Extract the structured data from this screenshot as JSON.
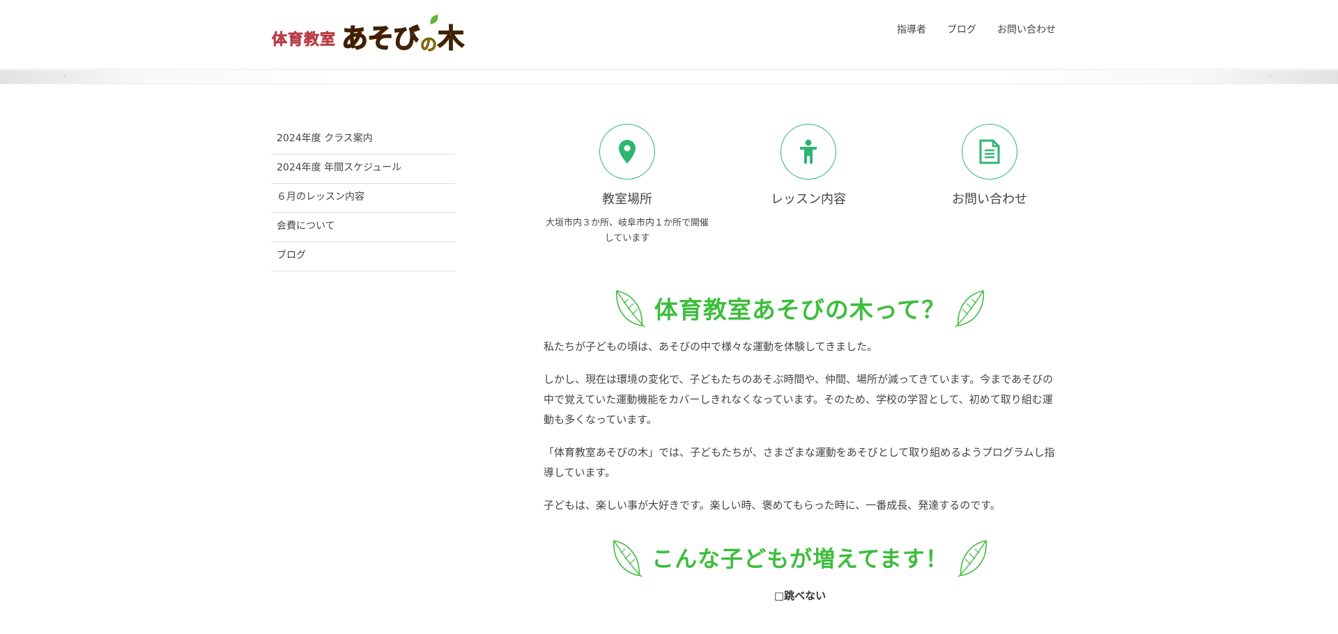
{
  "header": {
    "logo_sub": "体育教室",
    "logo_main_a": "あそび",
    "logo_main_no": "の",
    "logo_main_b": "木",
    "nav": [
      "指導者",
      "ブログ",
      "お問い合わせ"
    ]
  },
  "slider": {
    "prev_glyph": "‹",
    "next_glyph": "›"
  },
  "sidebar": {
    "items": [
      "2024年度 クラス案内",
      "2024年度 年間スケジュール",
      " ６月のレッスン内容",
      "会費について",
      "ブログ"
    ]
  },
  "features": [
    {
      "title": "教室場所",
      "desc": "大垣市内３か所、岐阜市内１か所で開催しています",
      "icon": "map-pin-icon"
    },
    {
      "title": "レッスン内容",
      "desc": "",
      "icon": "child-icon"
    },
    {
      "title": "お問い合わせ",
      "desc": "",
      "icon": "document-icon"
    }
  ],
  "section1": {
    "title": "体育教室あそびの木って？",
    "paragraphs": [
      "私たちが子どもの頃は、あそびの中で様々な運動を体験してきました。",
      "しかし、現在は環境の変化で、子どもたちのあそぶ時間や、仲間、場所が減ってきています。今まであそびの中で覚えていた運動機能をカバーしきれなくなっています。そのため、学校の学習として、初めて取り組む運動も多くなっています。",
      "「体育教室あそびの木」では、子どもたちが、さまざまな運動をあそびとして取り組めるようプログラムし指導しています。",
      "子どもは、楽しい事が大好きです。楽しい時、褒めてもらった時に、一番成長、発達するのです。"
    ]
  },
  "section2": {
    "title": "こんな子どもが増えてます！",
    "items": [
      "□跳べない"
    ]
  },
  "colors": {
    "accent_green": "#3dbd3d",
    "icon_green": "#2bb673",
    "logo_red": "#e8555f",
    "logo_brown": "#6b3a1a"
  }
}
